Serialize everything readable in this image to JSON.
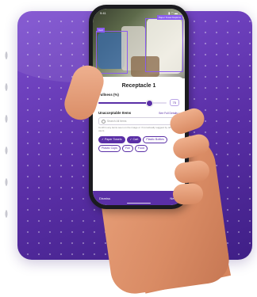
{
  "status_bar": {
    "time": "9:41",
    "icons": "▮ ◠ ▬"
  },
  "photo": {
    "detections": [
      {
        "label": "Cart"
      },
      {
        "label": "Paper Towel Napkins"
      }
    ]
  },
  "screen": {
    "title": "Receptacle 1",
    "fullness": {
      "label": "Fullness (%)",
      "value": "75",
      "fraction": 0.75
    },
    "unacceptable": {
      "label": "Unacceptable Items",
      "link": "See Full Details ›",
      "search_placeholder": "Search All Items",
      "hint": "Confirm any items seen on the image or if not actually suggest by other users",
      "chips": [
        {
          "label": "Paper Towels",
          "selected": true
        },
        {
          "label": "Cart",
          "selected": true
        },
        {
          "label": "Plastic Bottles",
          "selected": false
        },
        {
          "label": "Plastic Cups",
          "selected": false
        },
        {
          "label": "Foil",
          "selected": false
        },
        {
          "label": "Food",
          "selected": false
        }
      ]
    },
    "bottom_bar": {
      "left": "Dismiss",
      "right": "Next ›"
    }
  },
  "colors": {
    "brand": "#5a2fa6",
    "accent": "#8a5cf0"
  }
}
